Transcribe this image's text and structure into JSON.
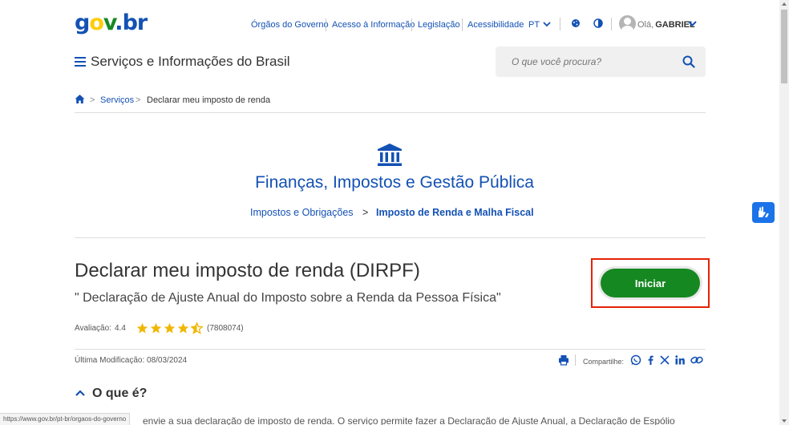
{
  "logo": {
    "g": "g",
    "o": "o",
    "v": "v",
    "dot": ".",
    "b": "b",
    "r": "r"
  },
  "topnav": {
    "items": [
      "Órgãos do Governo",
      "Acesso à Informação",
      "Legislação",
      "Acessibilidade"
    ],
    "language": "PT",
    "greeting": "Olá,",
    "username": "GABRIEL"
  },
  "header": {
    "site_title": "Serviços e Informações do Brasil",
    "search_placeholder": "O que você procura?"
  },
  "breadcrumb": {
    "arrow": ">",
    "services": "Serviços",
    "current": "Declarar meu imposto de renda"
  },
  "category": {
    "title": "Finanças, Impostos e Gestão Pública",
    "sub_link": "Impostos e Obrigações",
    "arrow": ">",
    "sub_current": "Imposto de Renda e Malha Fiscal"
  },
  "service": {
    "title": "Declarar meu imposto de renda (DIRPF)",
    "subtitle": "\" Declaração de Ajuste Anual do Imposto sobre a Renda da Pessoa Física\"",
    "rating_label": "Avaliação:",
    "rating_value": "4.4",
    "rating_stars": 4.4,
    "rating_count": "(7808074)",
    "start_label": "Iniciar",
    "modified": "Última Modificação: 08/03/2024",
    "share_label": "Compartilhe:"
  },
  "section": {
    "title": "O que é?",
    "body": "envie a sua declaração de imposto de renda. O serviço permite fazer a Declaração de Ajuste Anual, a Declaração de Espólio"
  },
  "status_bar": {
    "url": "https://www.gov.br/pt-br/orgaos-do-governo"
  },
  "colors": {
    "primary": "#1351b4",
    "success": "#168821",
    "highlight": "#e52207",
    "star": "#ffcd07"
  }
}
